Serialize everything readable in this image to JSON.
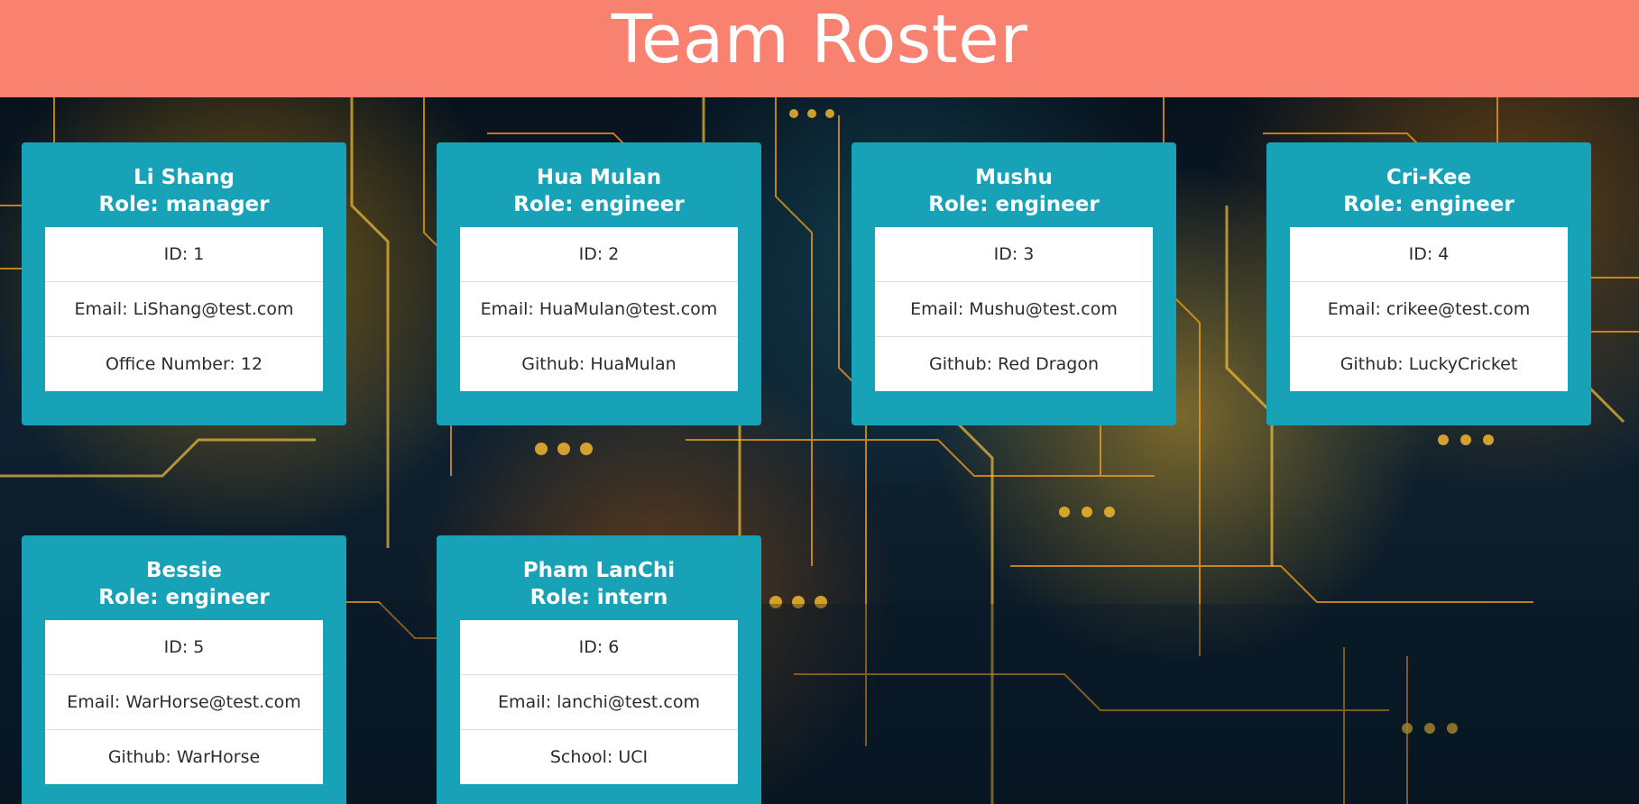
{
  "header": {
    "title": "Team Roster"
  },
  "colors": {
    "header_bg": "#f8816f",
    "card_bg": "#17a2b8",
    "card_text": "#ffffff",
    "list_bg": "#ffffff"
  },
  "background": {
    "description_icon": "circuit-board-image"
  },
  "employees": [
    {
      "name": "Li Shang",
      "role": "Role: manager",
      "id": "ID: 1",
      "email": "Email: LiShang@test.com",
      "extra": "Office Number: 12"
    },
    {
      "name": "Hua Mulan",
      "role": "Role: engineer",
      "id": "ID: 2",
      "email": "Email: HuaMulan@test.com",
      "extra": "Github: HuaMulan"
    },
    {
      "name": "Mushu",
      "role": "Role: engineer",
      "id": "ID: 3",
      "email": "Email: Mushu@test.com",
      "extra": "Github: Red Dragon"
    },
    {
      "name": "Cri-Kee",
      "role": "Role: engineer",
      "id": "ID: 4",
      "email": "Email: crikee@test.com",
      "extra": "Github: LuckyCricket"
    },
    {
      "name": "Bessie",
      "role": "Role: engineer",
      "id": "ID: 5",
      "email": "Email: WarHorse@test.com",
      "extra": "Github: WarHorse"
    },
    {
      "name": "Pham LanChi",
      "role": "Role: intern",
      "id": "ID: 6",
      "email": "Email: lanchi@test.com",
      "extra": "School: UCI"
    }
  ]
}
